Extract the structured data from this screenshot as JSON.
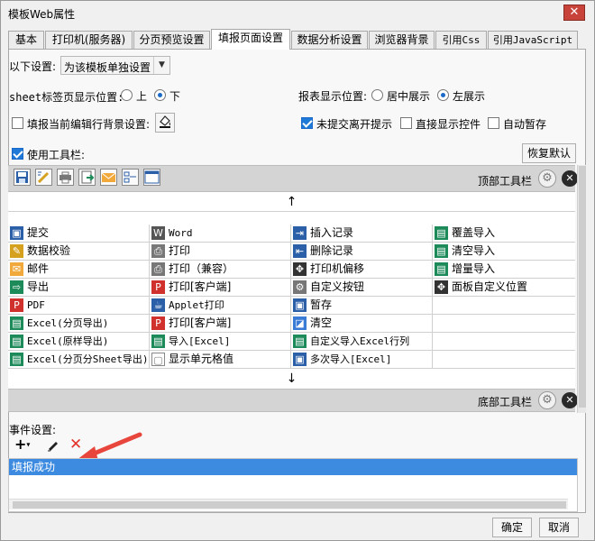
{
  "window": {
    "title": "模板Web属性",
    "close_symbol": "✕"
  },
  "tabs": [
    "基本",
    "打印机(服务器)",
    "分页预览设置",
    "填报页面设置",
    "数据分析设置",
    "浏览器背景",
    "引用Css",
    "引用JavaScript"
  ],
  "settings": {
    "scope_label": "以下设置:",
    "scope_value": "为该模板单独设置",
    "sheet_label": "sheet标签页显示位置:",
    "sheet_top": "上",
    "sheet_bottom": "下",
    "report_label": "报表显示位置:",
    "report_center": "居中展示",
    "report_left": "左展示",
    "fill_bg_label": "填报当前编辑行背景设置:",
    "unsubmit_label": "未提交离开提示",
    "direct_show_label": "直接显示控件",
    "auto_save_label": "自动暂存",
    "use_toolbar_label": "使用工具栏:",
    "restore_default": "恢复默认"
  },
  "toolbar": {
    "top_label": "顶部工具栏",
    "bottom_label": "底部工具栏",
    "up_arrow": "↑",
    "down_arrow": "↓"
  },
  "grid": [
    [
      "提交",
      "Word",
      "插入记录",
      "覆盖导入"
    ],
    [
      "数据校验",
      "打印",
      "删除记录",
      "清空导入"
    ],
    [
      "邮件",
      "打印（兼容）",
      "打印机偏移",
      "增量导入"
    ],
    [
      "导出",
      "打印[客户端]",
      "自定义按钮",
      "面板自定义位置"
    ],
    [
      "PDF",
      "Applet打印",
      "暂存",
      ""
    ],
    [
      "Excel(分页导出)",
      "打印[客户端]",
      "清空",
      ""
    ],
    [
      "Excel(原样导出)",
      "导入[Excel]",
      "自定义导入Excel行列",
      ""
    ],
    [
      "Excel(分页分Sheet导出)",
      "显示单元格值",
      "多次导入[Excel]",
      ""
    ]
  ],
  "events": {
    "label": "事件设置:",
    "items": [
      "填报成功"
    ]
  },
  "footer": {
    "ok": "确定",
    "cancel": "取消"
  },
  "colors": {
    "accent": "#3d8be0",
    "excel_green": "#1d8a5a",
    "pdf_red": "#d0312d"
  }
}
